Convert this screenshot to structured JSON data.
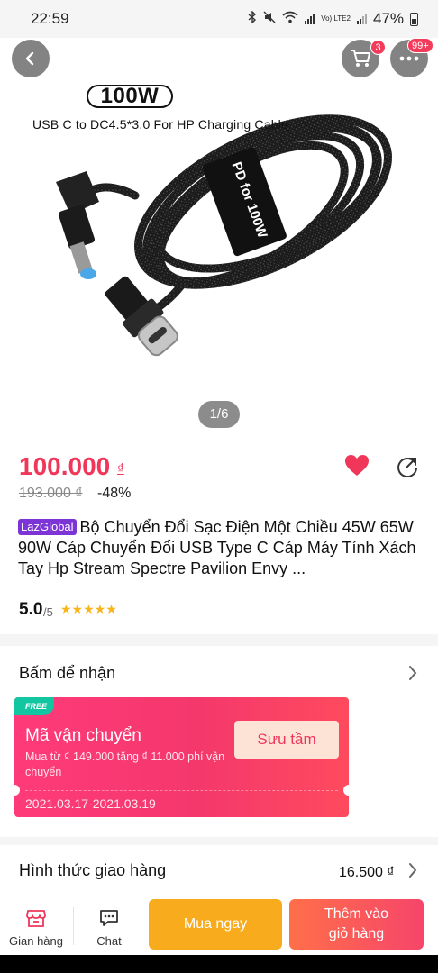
{
  "status_bar": {
    "time": "22:59",
    "battery": "47%",
    "network": "Vo) LTE2"
  },
  "header": {
    "cart_count": "3",
    "more_count": "99+"
  },
  "hero": {
    "title": "100W",
    "subtitle": "USB C to DC4.5*3.0 For HP Charging Cable",
    "cable_label": "PD for 100W",
    "counter": "1/6"
  },
  "product": {
    "price": "100.000",
    "currency": "₫",
    "old_price": "193.000 ₫",
    "discount": "-48%",
    "tag": "LazGlobal",
    "title": "Bộ Chuyển Đổi Sạc Điện Một Chiều 45W 65W 90W Cáp Chuyển Đổi USB Type C Cáp Máy Tính Xách Tay Hp Stream Spectre Pavilion Envy ...",
    "rating": "5.0",
    "rating_of": "/5",
    "stars": "★★★★★",
    "star_count": 5
  },
  "voucher_section": {
    "heading": "Bấm để nhận",
    "card": {
      "tag": "FREE",
      "title": "Mã vận chuyển",
      "description": "Mua từ ₫ 149.000 tặng ₫ 11.000 phí vận chuyển",
      "dates": "2021.03.17-2021.03.19",
      "button": "Sưu tầm"
    }
  },
  "shipping": {
    "label": "Hình thức giao hàng",
    "value": "16.500 ₫"
  },
  "bottom_bar": {
    "store_label": "Gian hàng",
    "chat_label": "Chat",
    "buy_label": "Mua ngay",
    "add_cart_line1": "Thêm vào",
    "add_cart_line2": "giỏ hàng"
  },
  "colors": {
    "accent": "#f0375a",
    "buy_button": "#f7ab1d",
    "star": "#f8b41c",
    "laz_tag": "#7d34d6"
  }
}
